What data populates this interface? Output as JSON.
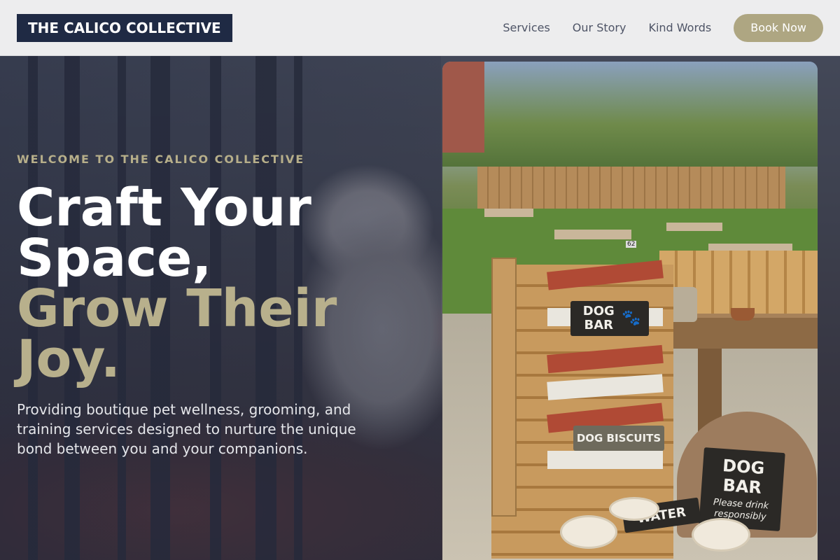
{
  "header": {
    "logo_text": "THE CALICO COLLECTIVE",
    "nav": [
      {
        "label": "Services"
      },
      {
        "label": "Our Story"
      },
      {
        "label": "Kind Words"
      }
    ],
    "cta_label": "Book Now"
  },
  "hero": {
    "eyebrow": "WELCOME TO THE CALICO COLLECTIVE",
    "headline_line1": "Craft Your",
    "headline_line2": "Space,",
    "headline_line3": "Grow Their",
    "headline_line4": "Joy.",
    "lede": "Providing boutique pet wellness, grooming, and training services designed to nurture the unique bond between you and your companions."
  },
  "photo": {
    "sign_dog_bar_top": "DOG BAR",
    "sign_biscuits": "DOG BISCUITS",
    "sign_dog_bar_big": "DOG BAR",
    "sign_drink": "Please drink responsibly",
    "sign_water": "WATER",
    "table_number": "62"
  },
  "colors": {
    "navy": "#1f2a44",
    "accent": "#aea682",
    "header_bg": "#ededee"
  }
}
